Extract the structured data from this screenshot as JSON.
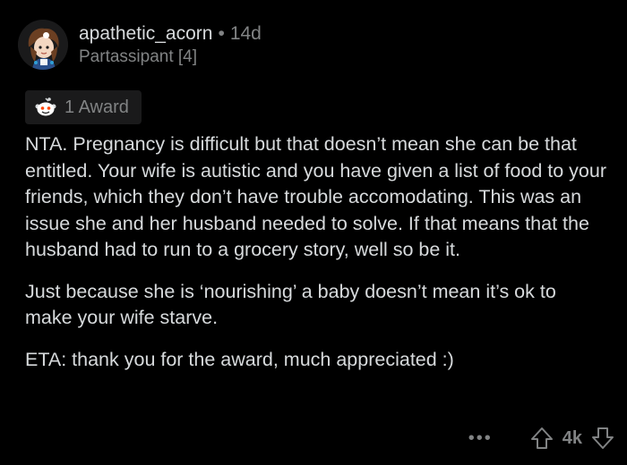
{
  "comment": {
    "username": "apathetic_acorn",
    "separator": "•",
    "age": "14d",
    "flair": "Partassipant [4]",
    "award_label": "1 Award",
    "paragraphs": [
      "NTA. Pregnancy is difficult but that doesn’t mean she can be that entitled. Your wife is autistic and you have given a list of food to your friends, which they don’t have trouble accomodating. This was an issue she and her husband needed to solve. If that means that the husband had to run to a grocery story, well so be it.",
      "Just because she is ‘nourishing’ a baby doesn’t mean it’s ok to make your wife starve.",
      "ETA: thank you for the award, much appreciated :)"
    ]
  },
  "footer": {
    "more_label": "•••",
    "score": "4k"
  },
  "icons": {
    "avatar": "avatar",
    "award": "award-icon",
    "upvote": "upvote-icon",
    "downvote": "downvote-icon"
  },
  "colors": {
    "background": "#000000",
    "text": "#d7dadc",
    "muted": "#818384",
    "chip": "#1a1a1b"
  }
}
